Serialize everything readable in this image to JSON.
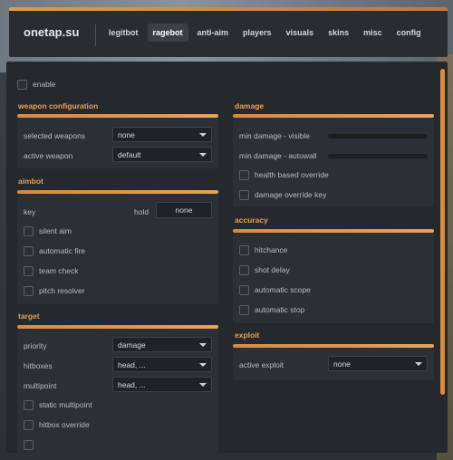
{
  "app": {
    "brand": "onetap.su"
  },
  "nav": {
    "tabs": [
      {
        "label": "legitbot"
      },
      {
        "label": "ragebot",
        "active": true
      },
      {
        "label": "anti-aim"
      },
      {
        "label": "players"
      },
      {
        "label": "visuals"
      },
      {
        "label": "skins"
      },
      {
        "label": "misc"
      },
      {
        "label": "config"
      }
    ]
  },
  "enable": {
    "label": "enable"
  },
  "weapon_configuration": {
    "title": "weapon configuration",
    "selected_weapons": {
      "label": "selected weapons",
      "value": "none"
    },
    "active_weapon": {
      "label": "active weapon",
      "value": "default"
    }
  },
  "aimbot": {
    "title": "aimbot",
    "key": {
      "label": "key",
      "mode": "hold",
      "value": "none"
    },
    "options": [
      {
        "label": "silent aim"
      },
      {
        "label": "automatic fire"
      },
      {
        "label": "team check"
      },
      {
        "label": "pitch resolver"
      }
    ]
  },
  "target": {
    "title": "target",
    "priority": {
      "label": "priority",
      "value": "damage"
    },
    "hitboxes": {
      "label": "hitboxes",
      "value": "head, ..."
    },
    "multipoint": {
      "label": "multipoint",
      "value": "head, ..."
    },
    "options": [
      {
        "label": "static multipoint"
      },
      {
        "label": "hitbox override"
      }
    ]
  },
  "damage": {
    "title": "damage",
    "min_visible": {
      "label": "min damage - visible"
    },
    "min_autowall": {
      "label": "min damage - autowall"
    },
    "options": [
      {
        "label": "health based override"
      },
      {
        "label": "damage override key"
      }
    ]
  },
  "accuracy": {
    "title": "accuracy",
    "options": [
      {
        "label": "hitchance"
      },
      {
        "label": "shot delay"
      },
      {
        "label": "automatic scope"
      },
      {
        "label": "automatic stop"
      }
    ]
  },
  "exploit": {
    "title": "exploit",
    "active_exploit": {
      "label": "active exploit",
      "value": "none"
    }
  },
  "colors": {
    "accent": "#d98a3d",
    "panel": "#25282d",
    "section": "#2c2f35"
  }
}
